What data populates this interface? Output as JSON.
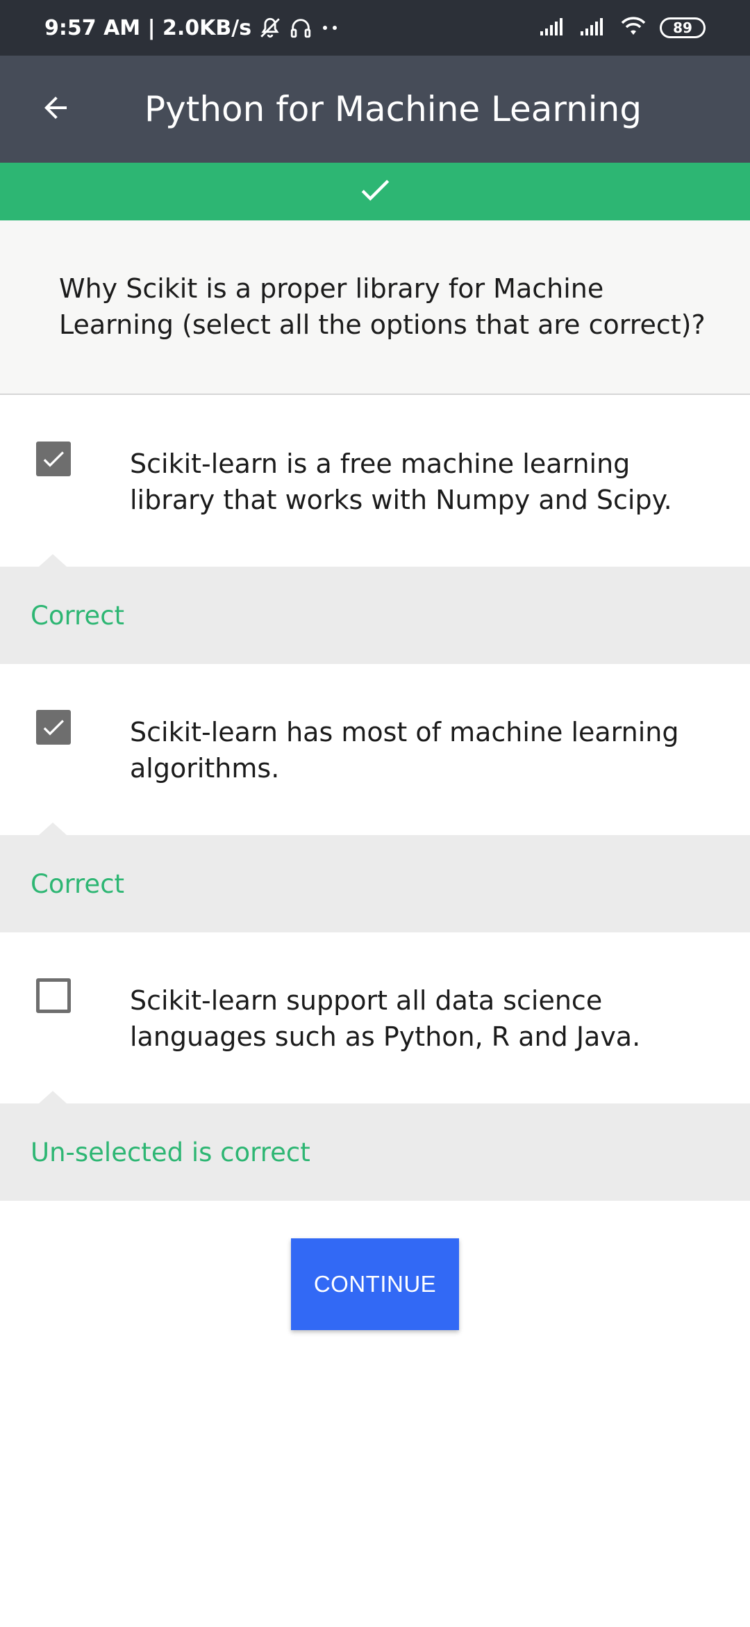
{
  "status_bar": {
    "time_speed": "9:57 AM | 2.0KB/s",
    "battery_level": "89",
    "icons": [
      "bell-off-icon",
      "headset-icon",
      "more-dots-icon",
      "signal-icon",
      "signal-icon",
      "wifi-icon",
      "battery-icon"
    ]
  },
  "app_bar": {
    "title": "Python for Machine Learning",
    "back_icon": "arrow-left-icon"
  },
  "banner": {
    "icon": "checkmark-icon",
    "color": "#2db673"
  },
  "question": {
    "text": "Why Scikit is a proper library for Machine Learning (select all the options that are correct)?"
  },
  "options": [
    {
      "text": "Scikit-learn is a free machine learning library that works with Numpy and Scipy.",
      "checked": true,
      "feedback": "Correct"
    },
    {
      "text": "Scikit-learn has most of machine learning algorithms.",
      "checked": true,
      "feedback": "Correct"
    },
    {
      "text": "Scikit-learn support all data science languages such as Python, R and Java.",
      "checked": false,
      "feedback": "Un-selected is correct"
    }
  ],
  "continue_label": "CONTINUE",
  "colors": {
    "status_bar": "#2c3038",
    "app_bar": "#464c58",
    "correct": "#2db673",
    "button": "#3269f5"
  }
}
